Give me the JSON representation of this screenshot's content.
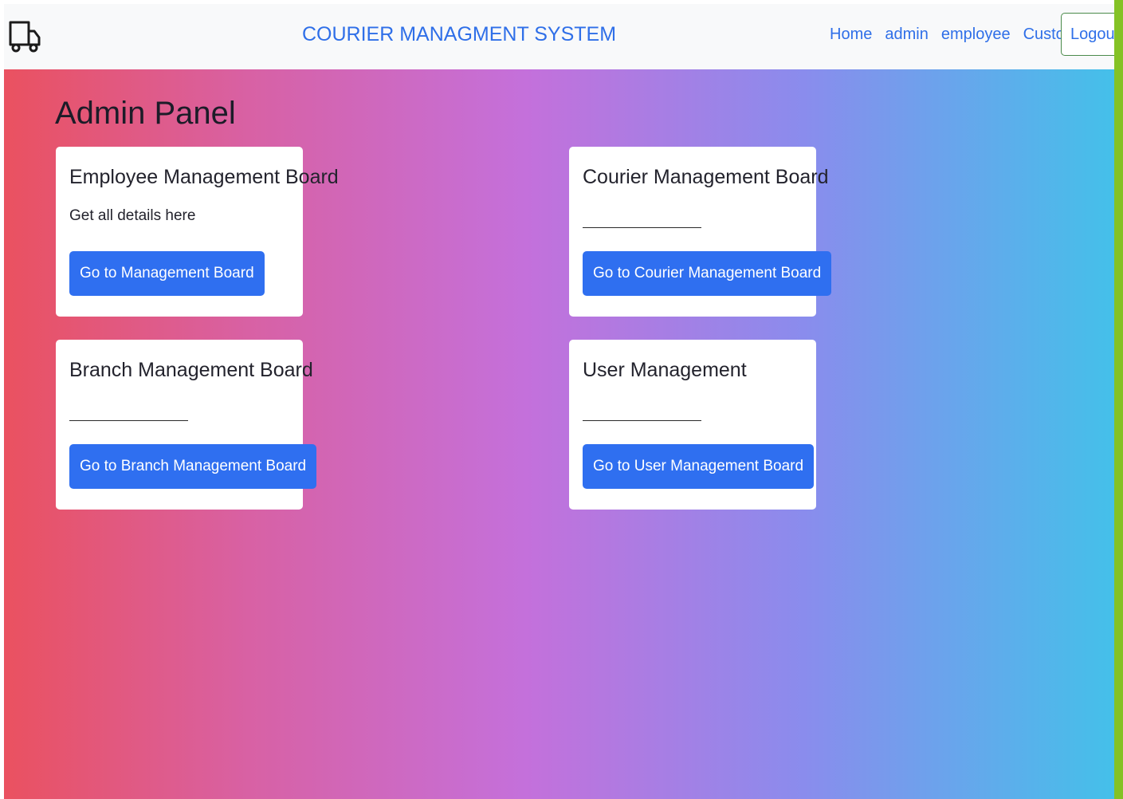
{
  "navbar": {
    "brand_icon": "truck-icon",
    "title": "COURIER MANAGMENT SYSTEM",
    "links": [
      {
        "label": "Home"
      },
      {
        "label": "admin"
      },
      {
        "label": "employee"
      },
      {
        "label": "Customer"
      }
    ],
    "logout_label": "Logout"
  },
  "main": {
    "title": "Admin Panel",
    "cards": [
      {
        "title": "Employee Management Board",
        "text": "Get all details here",
        "button_label": "Go to Management Board"
      },
      {
        "title": "Courier Management Board",
        "text": "",
        "button_label": "Go to Courier Management Board"
      },
      {
        "title": "Branch Management Board",
        "text": "",
        "button_label": "Go to Branch Management Board"
      },
      {
        "title": "User Management",
        "text": "",
        "button_label": "Go to User Management Board"
      }
    ]
  },
  "colors": {
    "link_blue": "#2f6fe8",
    "button_blue": "#2f6ff0",
    "gradient": [
      "#ea5160",
      "#d861a4",
      "#c470db",
      "#8a8ced",
      "#44c0ea"
    ],
    "edge_green": "#84c225"
  }
}
